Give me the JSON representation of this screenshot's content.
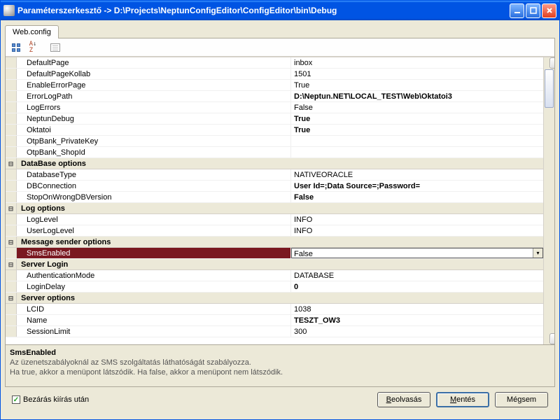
{
  "window": {
    "title": "Paraméterszerkesztő -> D:\\Projects\\NeptunConfigEditor\\ConfigEditor\\bin\\Debug"
  },
  "tab": {
    "label": "Web.config"
  },
  "selected": {
    "name": "SmsEnabled",
    "desc1": "Az üzenetszabályoknál az SMS szolgáltatás láthatóságát szabályozza.",
    "desc2": "Ha true, akkor a menüpont látszódik. Ha false, akkor a menüpont nem látszódik."
  },
  "rows": [
    {
      "t": "i",
      "k": "DefaultPage",
      "v": "inbox"
    },
    {
      "t": "i",
      "k": "DefaultPageKollab",
      "v": "1501"
    },
    {
      "t": "i",
      "k": "EnableErrorPage",
      "v": "True"
    },
    {
      "t": "i",
      "k": "ErrorLogPath",
      "v": "D:\\Neptun.NET\\LOCAL_TEST\\Web\\Oktatoi3",
      "b": true
    },
    {
      "t": "i",
      "k": "LogErrors",
      "v": "False"
    },
    {
      "t": "i",
      "k": "NeptunDebug",
      "v": "True",
      "b": true
    },
    {
      "t": "i",
      "k": "Oktatoi",
      "v": "True",
      "b": true
    },
    {
      "t": "i",
      "k": "OtpBank_PrivateKey",
      "v": ""
    },
    {
      "t": "i",
      "k": "OtpBank_ShopId",
      "v": ""
    },
    {
      "t": "c",
      "k": "DataBase options"
    },
    {
      "t": "i",
      "k": "DatabaseType",
      "v": "NATIVEORACLE"
    },
    {
      "t": "i",
      "k": "DBConnection",
      "v": "User Id=;Data Source=;Password=",
      "b": true
    },
    {
      "t": "i",
      "k": "StopOnWrongDBVersion",
      "v": "False",
      "b": true
    },
    {
      "t": "c",
      "k": "Log options"
    },
    {
      "t": "i",
      "k": "LogLevel",
      "v": "INFO"
    },
    {
      "t": "i",
      "k": "UserLogLevel",
      "v": "INFO"
    },
    {
      "t": "c",
      "k": "Message sender options"
    },
    {
      "t": "i",
      "k": "SmsEnabled",
      "v": "False",
      "sel": true
    },
    {
      "t": "c",
      "k": "Server Login"
    },
    {
      "t": "i",
      "k": "AuthenticationMode",
      "v": "DATABASE"
    },
    {
      "t": "i",
      "k": "LoginDelay",
      "v": "0",
      "b": true
    },
    {
      "t": "c",
      "k": "Server options"
    },
    {
      "t": "i",
      "k": "LCID",
      "v": "1038"
    },
    {
      "t": "i",
      "k": "Name",
      "v": "TESZT_OW3",
      "b": true
    },
    {
      "t": "i",
      "k": "SessionLimit",
      "v": "300"
    }
  ],
  "footer": {
    "checkbox_label": "Bezárás kiírás után",
    "btn_load": "Beolvasás",
    "btn_save": "Mentés",
    "btn_cancel": "Mégsem"
  }
}
